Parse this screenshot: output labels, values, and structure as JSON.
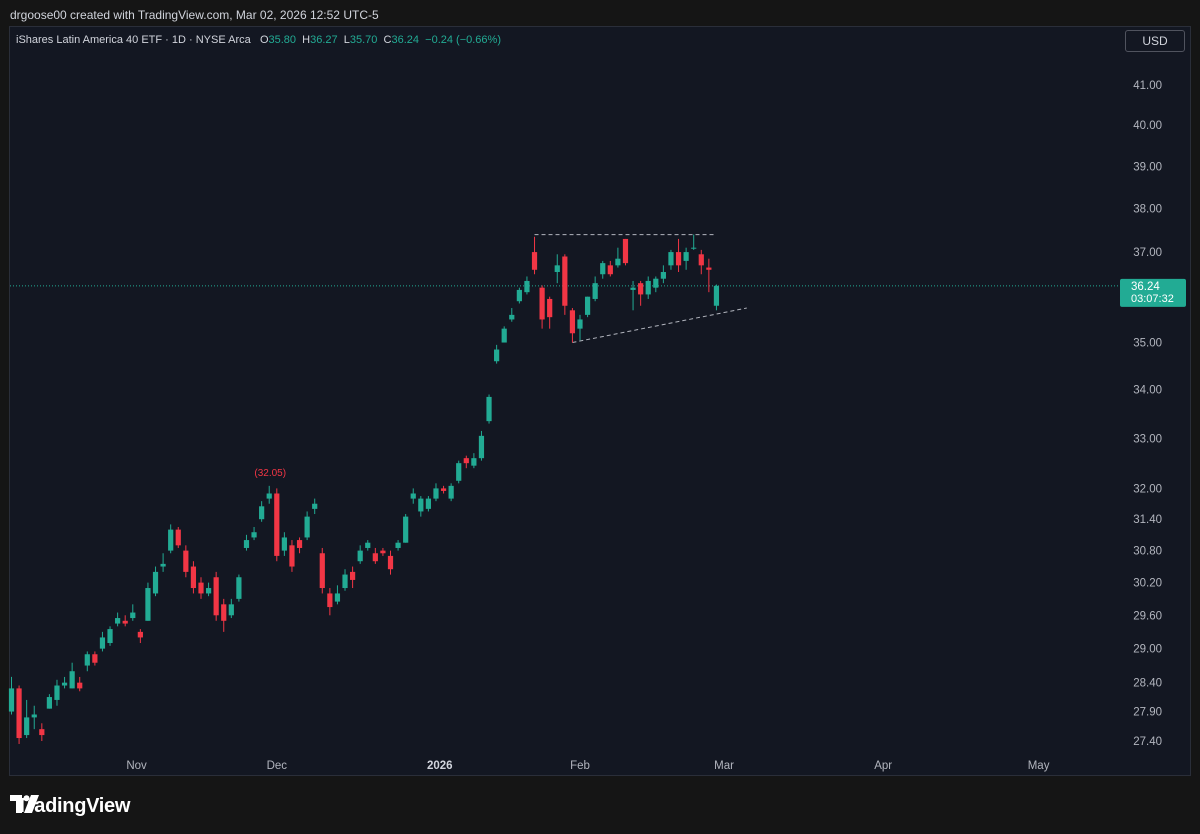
{
  "header": {
    "creator_line": "drgoose00 created with TradingView.com, Mar 02, 2026 12:52 UTC-5"
  },
  "legend": {
    "name": "iShares Latin America 40 ETF · 1D · NYSE Arca",
    "o_label": "O",
    "o": "35.80",
    "h_label": "H",
    "h": "36.27",
    "l_label": "L",
    "l": "35.70",
    "c_label": "C",
    "c": "36.24",
    "change": "−0.24 (−0.66%)"
  },
  "currency_button": "USD",
  "price_tag": {
    "price": "36.24",
    "countdown": "03:07:32"
  },
  "high_annotation": "(32.05)",
  "brand": "TradingView",
  "colors": {
    "up": "#22ab94",
    "down": "#f23645",
    "background": "#131722",
    "text": "#b2b5be",
    "line": "#b2b5be"
  },
  "chart_data": {
    "type": "candlestick",
    "scale": "log",
    "ylim": [
      27.2,
      41.4
    ],
    "y_ticks": [
      "41.00",
      "40.00",
      "39.00",
      "38.00",
      "37.00",
      "36.00",
      "35.00",
      "34.00",
      "33.00",
      "32.00",
      "31.40",
      "30.80",
      "30.20",
      "29.60",
      "29.00",
      "28.40",
      "27.90",
      "27.40"
    ],
    "x_ticks": [
      {
        "label": "Nov",
        "bold": false
      },
      {
        "label": "Dec",
        "bold": false
      },
      {
        "label": "2026",
        "bold": true
      },
      {
        "label": "Feb",
        "bold": false
      },
      {
        "label": "Mar",
        "bold": false
      },
      {
        "label": "Apr",
        "bold": false
      },
      {
        "label": "May",
        "bold": false
      }
    ],
    "candles": [
      [
        27.9,
        28.3,
        28.5,
        27.85
      ],
      [
        28.3,
        27.45,
        28.35,
        27.35
      ],
      [
        27.5,
        27.8,
        28.1,
        27.45
      ],
      [
        27.8,
        27.85,
        28.0,
        27.6
      ],
      [
        27.6,
        27.5,
        27.7,
        27.4
      ],
      [
        27.95,
        28.15,
        28.2,
        27.95
      ],
      [
        28.1,
        28.35,
        28.45,
        28.0
      ],
      [
        28.35,
        28.4,
        28.5,
        28.3
      ],
      [
        28.3,
        28.6,
        28.75,
        28.3
      ],
      [
        28.4,
        28.3,
        28.5,
        28.25
      ],
      [
        28.7,
        28.9,
        28.95,
        28.6
      ],
      [
        28.9,
        28.75,
        28.95,
        28.7
      ],
      [
        29.0,
        29.2,
        29.3,
        28.95
      ],
      [
        29.1,
        29.35,
        29.4,
        29.05
      ],
      [
        29.45,
        29.55,
        29.65,
        29.4
      ],
      [
        29.5,
        29.45,
        29.6,
        29.4
      ],
      [
        29.55,
        29.65,
        29.8,
        29.5
      ],
      [
        29.3,
        29.2,
        29.35,
        29.1
      ],
      [
        29.5,
        30.1,
        30.2,
        29.5
      ],
      [
        30.0,
        30.4,
        30.5,
        29.95
      ],
      [
        30.5,
        30.55,
        30.75,
        30.4
      ],
      [
        30.8,
        31.2,
        31.3,
        30.75
      ],
      [
        31.2,
        30.9,
        31.25,
        30.85
      ],
      [
        30.8,
        30.4,
        30.9,
        30.3
      ],
      [
        30.5,
        30.1,
        30.6,
        30.0
      ],
      [
        30.2,
        30.0,
        30.3,
        29.9
      ],
      [
        30.0,
        30.1,
        30.2,
        29.95
      ],
      [
        30.3,
        29.6,
        30.4,
        29.5
      ],
      [
        29.8,
        29.5,
        29.9,
        29.3
      ],
      [
        29.6,
        29.8,
        29.9,
        29.55
      ],
      [
        29.9,
        30.3,
        30.35,
        29.85
      ],
      [
        30.85,
        31.0,
        31.1,
        30.8
      ],
      [
        31.05,
        31.15,
        31.25,
        31.0
      ],
      [
        31.4,
        31.65,
        31.75,
        31.35
      ],
      [
        31.8,
        31.9,
        32.05,
        31.7
      ],
      [
        31.9,
        30.7,
        32.0,
        30.6
      ],
      [
        30.8,
        31.05,
        31.15,
        30.7
      ],
      [
        30.9,
        30.5,
        31.0,
        30.4
      ],
      [
        31.0,
        30.85,
        31.05,
        30.75
      ],
      [
        31.05,
        31.45,
        31.55,
        31.0
      ],
      [
        31.6,
        31.7,
        31.8,
        31.5
      ],
      [
        30.75,
        30.1,
        30.85,
        30.0
      ],
      [
        30.0,
        29.75,
        30.1,
        29.6
      ],
      [
        29.85,
        30.0,
        30.15,
        29.8
      ],
      [
        30.1,
        30.35,
        30.45,
        30.05
      ],
      [
        30.4,
        30.25,
        30.5,
        30.1
      ],
      [
        30.6,
        30.8,
        30.9,
        30.55
      ],
      [
        30.85,
        30.95,
        31.0,
        30.8
      ],
      [
        30.75,
        30.6,
        30.85,
        30.55
      ],
      [
        30.8,
        30.75,
        30.85,
        30.7
      ],
      [
        30.7,
        30.45,
        30.8,
        30.35
      ],
      [
        30.85,
        30.95,
        31.0,
        30.8
      ],
      [
        30.95,
        31.45,
        31.5,
        30.95
      ],
      [
        31.8,
        31.9,
        32.0,
        31.7
      ],
      [
        31.55,
        31.8,
        31.85,
        31.45
      ],
      [
        31.6,
        31.8,
        31.85,
        31.55
      ],
      [
        31.8,
        32.0,
        32.1,
        31.75
      ],
      [
        32.0,
        31.95,
        32.05,
        31.9
      ],
      [
        31.8,
        32.05,
        32.1,
        31.75
      ],
      [
        32.15,
        32.5,
        32.55,
        32.1
      ],
      [
        32.6,
        32.5,
        32.65,
        32.4
      ],
      [
        32.45,
        32.6,
        32.7,
        32.4
      ],
      [
        32.6,
        33.05,
        33.15,
        32.55
      ],
      [
        33.35,
        33.85,
        33.9,
        33.3
      ],
      [
        34.6,
        34.85,
        34.95,
        34.55
      ],
      [
        35.0,
        35.3,
        35.35,
        35.0
      ],
      [
        35.5,
        35.6,
        35.75,
        35.45
      ],
      [
        35.9,
        36.15,
        36.2,
        35.85
      ],
      [
        36.1,
        36.35,
        36.45,
        36.05
      ],
      [
        37.0,
        36.6,
        37.35,
        36.5
      ],
      [
        36.2,
        35.5,
        36.25,
        35.3
      ],
      [
        35.95,
        35.55,
        36.0,
        35.3
      ],
      [
        36.55,
        36.7,
        36.95,
        36.3
      ],
      [
        36.9,
        35.8,
        36.95,
        35.6
      ],
      [
        35.7,
        35.2,
        35.75,
        35.0
      ],
      [
        35.3,
        35.5,
        35.6,
        35.05
      ],
      [
        35.6,
        36.0,
        36.0,
        35.55
      ],
      [
        35.95,
        36.3,
        36.45,
        35.9
      ],
      [
        36.5,
        36.75,
        36.8,
        36.4
      ],
      [
        36.7,
        36.5,
        36.8,
        36.45
      ],
      [
        36.7,
        36.85,
        37.1,
        36.65
      ],
      [
        37.3,
        36.75,
        37.3,
        36.7
      ],
      [
        36.15,
        36.2,
        36.35,
        35.7
      ],
      [
        36.3,
        36.05,
        36.35,
        35.8
      ],
      [
        36.05,
        36.35,
        36.45,
        35.95
      ],
      [
        36.2,
        36.4,
        36.45,
        36.1
      ],
      [
        36.4,
        36.55,
        36.7,
        36.3
      ],
      [
        36.7,
        37.0,
        37.05,
        36.6
      ],
      [
        37.0,
        36.7,
        37.3,
        36.55
      ],
      [
        36.8,
        37.0,
        37.1,
        36.6
      ],
      [
        37.1,
        37.1,
        37.4,
        37.05
      ],
      [
        36.95,
        36.7,
        37.05,
        36.5
      ],
      [
        36.65,
        36.6,
        36.85,
        36.1
      ],
      [
        35.8,
        36.24,
        36.27,
        35.7
      ]
    ]
  }
}
